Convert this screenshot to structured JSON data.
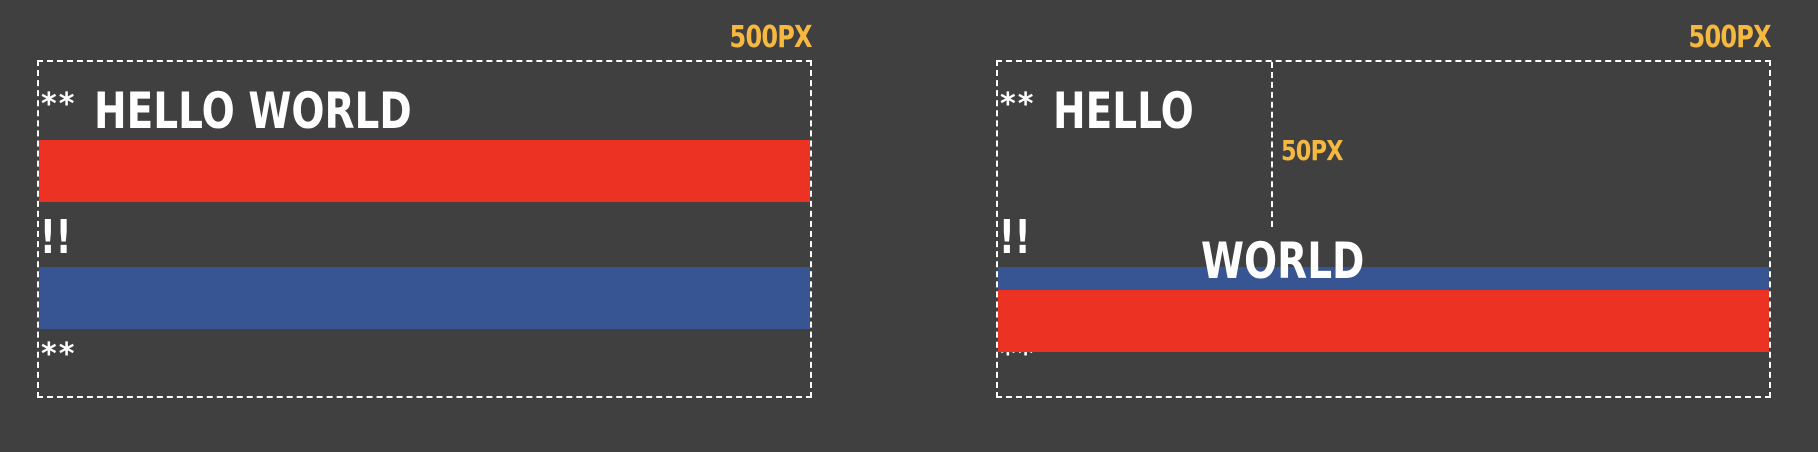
{
  "colors": {
    "background": "#404040",
    "dimension": "#f5b841",
    "text": "#ffffff",
    "red_block": "#eb3223",
    "blue_block": "#375592",
    "outline": "#ffffff"
  },
  "left_example": {
    "width_label": "500PX",
    "leading_stars": "**",
    "heading": "HELLO WORLD",
    "middle_marks": "!!",
    "trailing_stars": "**"
  },
  "right_example": {
    "width_label": "500PX",
    "leading_stars": "**",
    "heading_first": "HELLO",
    "heading_second": "WORLD",
    "middle_marks": "!!",
    "trailing_stars": "**",
    "guide_label": "50PX"
  }
}
